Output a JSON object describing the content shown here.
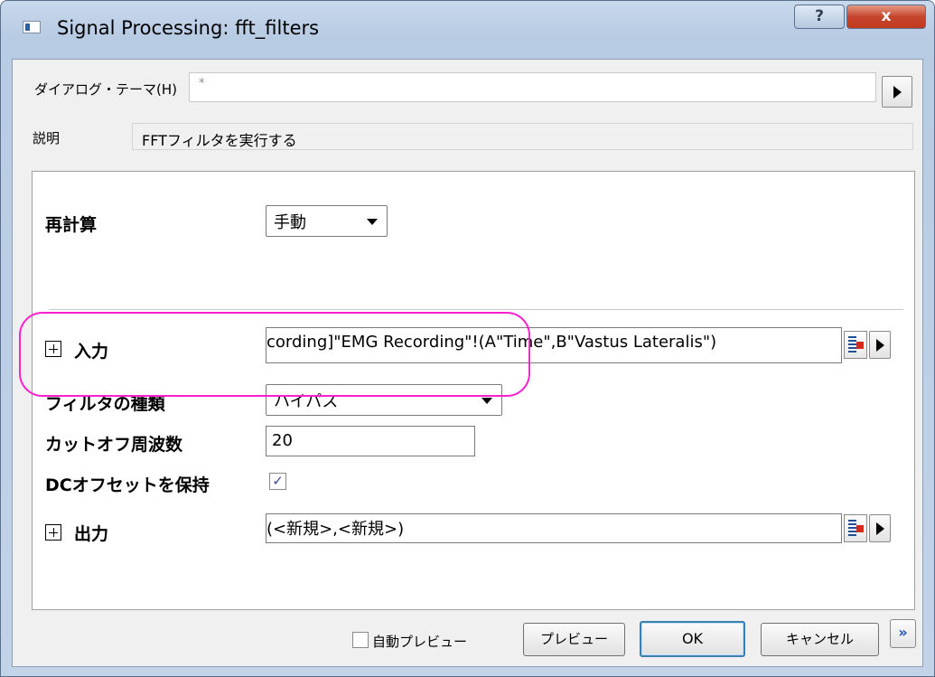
{
  "window": {
    "title": "Signal Processing: fft_filters"
  },
  "theme": {
    "label": "ダイアログ・テーマ(H)",
    "value": "*"
  },
  "description": {
    "label": "説明",
    "value": "FFTフィルタを実行する"
  },
  "recalc": {
    "label": "再計算",
    "value": "手動"
  },
  "input": {
    "label": "入力",
    "value": "cording]\"EMG Recording\"!(A\"Time\",B\"Vastus Lateralis\")"
  },
  "filter_type": {
    "label": "フィルタの種類",
    "value": "ハイパス"
  },
  "cutoff": {
    "label": "カットオフ周波数",
    "value": "20"
  },
  "dc_offset": {
    "label": "DCオフセットを保持",
    "checked": "✓"
  },
  "output": {
    "label": "出力",
    "value": "(<新規>,<新規>)"
  },
  "footer": {
    "auto_preview": "自動プレビュー",
    "preview": "プレビュー",
    "ok": "OK",
    "cancel": "キャンセル",
    "expand": "»"
  },
  "titlebar": {
    "help": "?",
    "close": "x"
  },
  "colors": {
    "highlight": "#ff1fcf",
    "close_button": "#c23a20"
  }
}
